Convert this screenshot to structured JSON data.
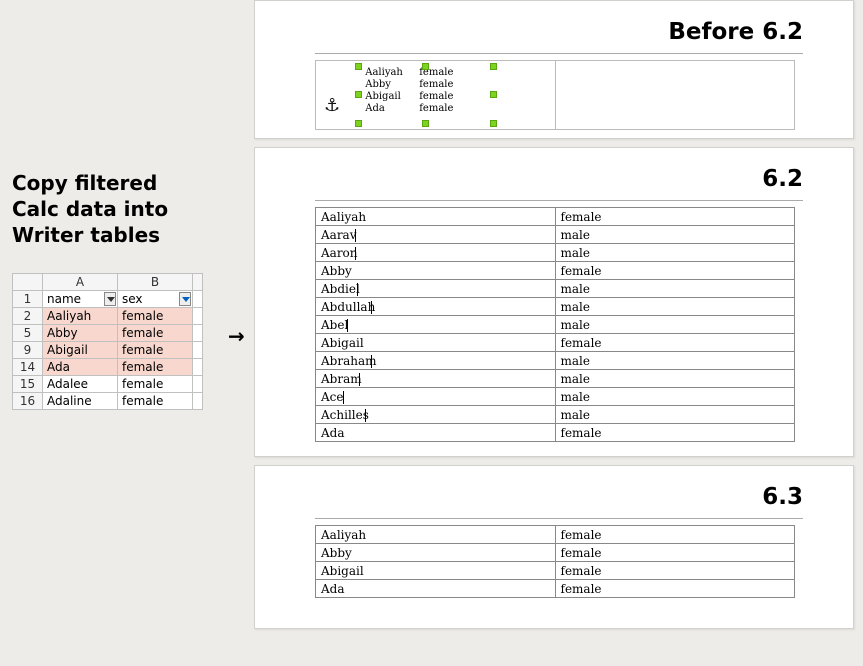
{
  "left": {
    "title_l1": "Copy filtered",
    "title_l2": "Calc data into",
    "title_l3": "Writer tables",
    "col_a": "A",
    "col_b": "B",
    "rows": [
      {
        "n": "1",
        "name": "name",
        "sex": "sex",
        "hl": false,
        "hdr": true
      },
      {
        "n": "2",
        "name": "Aaliyah",
        "sex": "female",
        "hl": true
      },
      {
        "n": "5",
        "name": "Abby",
        "sex": "female",
        "hl": true
      },
      {
        "n": "9",
        "name": "Abigail",
        "sex": "female",
        "hl": true
      },
      {
        "n": "14",
        "name": "Ada",
        "sex": "female",
        "hl": true
      },
      {
        "n": "15",
        "name": "Adalee",
        "sex": "female",
        "hl": false
      },
      {
        "n": "16",
        "name": "Adaline",
        "sex": "female",
        "hl": false
      }
    ]
  },
  "arrow": "→",
  "anchor_glyph": "⚓",
  "panels": {
    "before": {
      "title": "Before 6.2",
      "ole_rows": [
        {
          "name": "Aaliyah",
          "sex": "female"
        },
        {
          "name": "Abby",
          "sex": "female"
        },
        {
          "name": "Abigail",
          "sex": "female"
        },
        {
          "name": "Ada",
          "sex": "female"
        }
      ]
    },
    "v62": {
      "title": "6.2",
      "rows": [
        {
          "name": "Aaliyah",
          "sex": "female",
          "c": false
        },
        {
          "name": "Aarav",
          "sex": "male",
          "c": true,
          "cw": 34
        },
        {
          "name": "Aaron",
          "sex": "male",
          "c": true,
          "cw": 34
        },
        {
          "name": "Abby",
          "sex": "female",
          "c": false
        },
        {
          "name": "Abdiel",
          "sex": "male",
          "c": true,
          "cw": 36
        },
        {
          "name": "Abdullah",
          "sex": "male",
          "c": true,
          "cw": 50
        },
        {
          "name": "Abel",
          "sex": "male",
          "c": true,
          "cw": 26
        },
        {
          "name": "Abigail",
          "sex": "female",
          "c": false
        },
        {
          "name": "Abraham",
          "sex": "male",
          "c": true,
          "cw": 50
        },
        {
          "name": "Abram",
          "sex": "male",
          "c": true,
          "cw": 38
        },
        {
          "name": "Ace",
          "sex": "male",
          "c": true,
          "cw": 22
        },
        {
          "name": "Achilles",
          "sex": "male",
          "c": true,
          "cw": 44
        },
        {
          "name": "Ada",
          "sex": "female",
          "c": false
        }
      ]
    },
    "v63": {
      "title": "6.3",
      "rows": [
        {
          "name": "Aaliyah",
          "sex": "female"
        },
        {
          "name": "Abby",
          "sex": "female"
        },
        {
          "name": "Abigail",
          "sex": "female"
        },
        {
          "name": "Ada",
          "sex": "female"
        }
      ]
    }
  }
}
